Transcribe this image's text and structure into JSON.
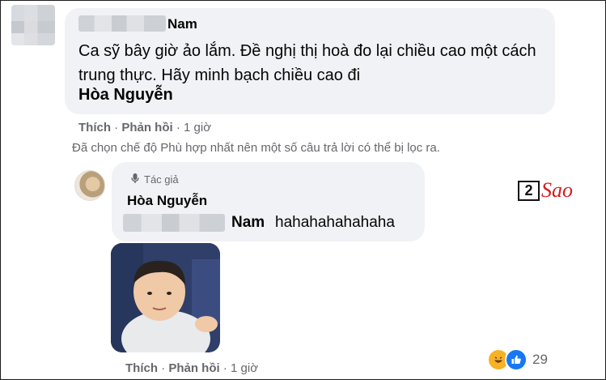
{
  "top_comment": {
    "author": "Nam",
    "text": "Ca sỹ bây giờ ảo lắm. Đề nghị thị hoà đo lại chiều cao một cách trung thực. Hãy minh bạch chiều cao đi",
    "mention": "Hòa Nguyễn",
    "like_label": "Thích",
    "reply_label": "Phản hồi",
    "time": "1 giờ"
  },
  "filter_note": "Đã chọn chế độ Phù hợp nhất nên một số câu trả lời có thể bị lọc ra.",
  "reply": {
    "badge_label": "Tác giả",
    "author": "Hòa Nguyễn",
    "mention": "Nam",
    "text": "hahahahahahaha",
    "like_label": "Thích",
    "reply_label": "Phản hồi",
    "time": "1 giờ",
    "reaction_count": "29"
  },
  "sep": "·",
  "watermark": {
    "box": "2",
    "text": "Sao"
  },
  "colors": {
    "bubble": "#f0f2f5",
    "meta": "#65676b",
    "like_blue": "#1877f2",
    "haha_yellow": "#f7b125",
    "logo_red": "#d11d1d"
  },
  "icons": {
    "author_badge": "microphone-icon",
    "reaction_haha": "haha-emoji-icon",
    "reaction_like": "like-icon"
  }
}
